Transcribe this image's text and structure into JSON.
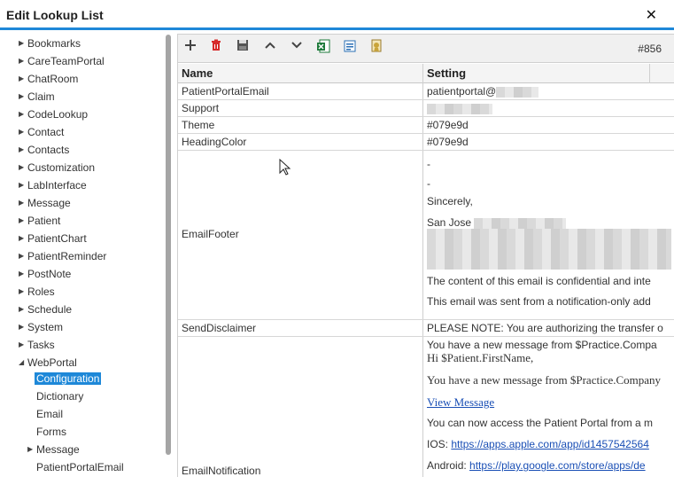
{
  "dialog": {
    "title": "Edit Lookup List",
    "close_glyph": "✕"
  },
  "tree": [
    {
      "label": "Bookmarks",
      "expanded": false
    },
    {
      "label": "CareTeamPortal",
      "expanded": false
    },
    {
      "label": "ChatRoom",
      "expanded": false
    },
    {
      "label": "Claim",
      "expanded": false
    },
    {
      "label": "CodeLookup",
      "expanded": false
    },
    {
      "label": "Contact",
      "expanded": false
    },
    {
      "label": "Contacts",
      "expanded": false
    },
    {
      "label": "Customization",
      "expanded": false
    },
    {
      "label": "LabInterface",
      "expanded": false
    },
    {
      "label": "Message",
      "expanded": false
    },
    {
      "label": "Patient",
      "expanded": false
    },
    {
      "label": "PatientChart",
      "expanded": false
    },
    {
      "label": "PatientReminder",
      "expanded": false
    },
    {
      "label": "PostNote",
      "expanded": false
    },
    {
      "label": "Roles",
      "expanded": false
    },
    {
      "label": "Schedule",
      "expanded": false
    },
    {
      "label": "System",
      "expanded": false
    },
    {
      "label": "Tasks",
      "expanded": false
    },
    {
      "label": "WebPortal",
      "expanded": true
    },
    {
      "label": "Configuration",
      "selected": true
    },
    {
      "label": "Dictionary"
    },
    {
      "label": "Email"
    },
    {
      "label": "Forms"
    },
    {
      "label": "Message",
      "expanded": false
    },
    {
      "label": "PatientPortalEmail"
    }
  ],
  "toolbar": {
    "icons": [
      "add-icon",
      "delete-icon",
      "save-icon",
      "move-up-icon",
      "move-down-icon",
      "export-excel-icon",
      "export-csv-icon",
      "certificate-icon"
    ],
    "record_id": "#856"
  },
  "grid": {
    "columns": [
      "Name",
      "Setting"
    ],
    "rows": {
      "patient_portal_email": {
        "name": "PatientPortalEmail",
        "setting": "patientportal@"
      },
      "support": {
        "name": "Support",
        "setting": ""
      },
      "theme": {
        "name": "Theme",
        "setting": "#079e9d"
      },
      "heading_color": {
        "name": "HeadingColor",
        "setting": "#079e9d"
      },
      "email_footer": {
        "name": "EmailFooter",
        "lines": [
          "-",
          "-",
          "Sincerely,",
          "San Jose",
          "The content of this email is confidential and inte",
          "This email was sent from a notification-only add"
        ]
      },
      "send_disclaimer": {
        "name": "SendDisclaimer",
        "setting": "PLEASE NOTE: You are authorizing the transfer o"
      },
      "email_notification": {
        "name": "EmailNotification",
        "line1": "You have a new message from $Practice.Compa",
        "line2": "Hi $Patient.FirstName,",
        "line3": "You have a new message from $Practice.Company",
        "link_text": "View Message",
        "line4": "You can now access the Patient Portal from a m",
        "ios_label": "IOS:",
        "ios_link": "https://apps.apple.com/app/id1457542564",
        "android_label": "Android:",
        "android_link": "https://play.google.com/store/apps/de"
      }
    }
  },
  "colors": {
    "accent": "#1e88d8",
    "theme": "#079e9d"
  }
}
